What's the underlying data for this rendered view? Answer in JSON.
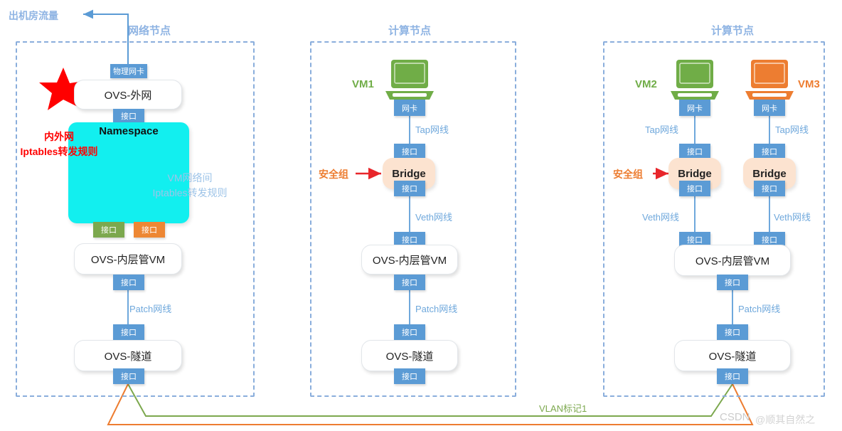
{
  "diagram": {
    "outbound_traffic_label": "出机房流量",
    "vlan_tag_label": "VLAN标记1",
    "watermark": "CSDN",
    "watermark_author": "@顺其自然之",
    "colors": {
      "port_blue": "#5B9BD5",
      "port_green": "#7CA84E",
      "port_orange": "#ED8734",
      "namespace_cyan": "#12EFEF",
      "bridge_peach": "#FCE3D0",
      "vm_green": "#70AD47",
      "vm_orange": "#ED7D31",
      "node_border": "#8AAEDC",
      "wire_blue": "#6FA8DC",
      "alert_red": "#FF0000"
    }
  },
  "network_node": {
    "title": "网络节点",
    "physical_nic": "物理网卡",
    "ovs_external": "OVS-外网",
    "port_to_namespace": "接口",
    "namespace": "Namespace",
    "iptables_note_red_line1": "内外网",
    "iptables_note_red_line2": "Iptables转发规则",
    "iptables_note_blue_line1": "VM网络间",
    "iptables_note_blue_line2": "Iptables转发规则",
    "port_green": "接口",
    "port_orange": "接口",
    "ovs_internal": "OVS-内层管VM",
    "port_internal_bottom": "接口",
    "patch_wire": "Patch网线",
    "port_tunnel_top": "接口",
    "ovs_tunnel": "OVS-隧道",
    "port_tunnel_bottom": "接口"
  },
  "compute_node_1": {
    "title": "计算节点",
    "vm_label": "VM1",
    "nic": "网卡",
    "tap_wire": "Tap网线",
    "port_bridge_top": "接口",
    "bridge": "Bridge",
    "security_group": "安全组",
    "port_bridge_bottom": "接口",
    "veth_wire": "Veth网线",
    "port_internal_top": "接口",
    "ovs_internal": "OVS-内层管VM",
    "port_internal_bottom": "接口",
    "patch_wire": "Patch网线",
    "port_tunnel_top": "接口",
    "ovs_tunnel": "OVS-隧道",
    "port_tunnel_bottom": "接口"
  },
  "compute_node_2": {
    "title": "计算节点",
    "vm2_label": "VM2",
    "vm3_label": "VM3",
    "nic_vm2": "网卡",
    "nic_vm3": "网卡",
    "tap_wire_vm2": "Tap网线",
    "tap_wire_vm3": "Tap网线",
    "port_bridge_vm2_top": "接口",
    "port_bridge_vm3_top": "接口",
    "bridge_vm2": "Bridge",
    "bridge_vm3": "Bridge",
    "security_group": "安全组",
    "port_bridge_vm2_bottom": "接口",
    "port_bridge_vm3_bottom": "接口",
    "veth_wire_vm2": "Veth网线",
    "veth_wire_vm3": "Veth网线",
    "port_internal_left": "接口",
    "port_internal_right": "接口",
    "ovs_internal": "OVS-内层管VM",
    "port_internal_bottom": "接口",
    "patch_wire": "Patch网线",
    "port_tunnel_top": "接口",
    "ovs_tunnel": "OVS-隧道",
    "port_tunnel_bottom": "接口"
  }
}
